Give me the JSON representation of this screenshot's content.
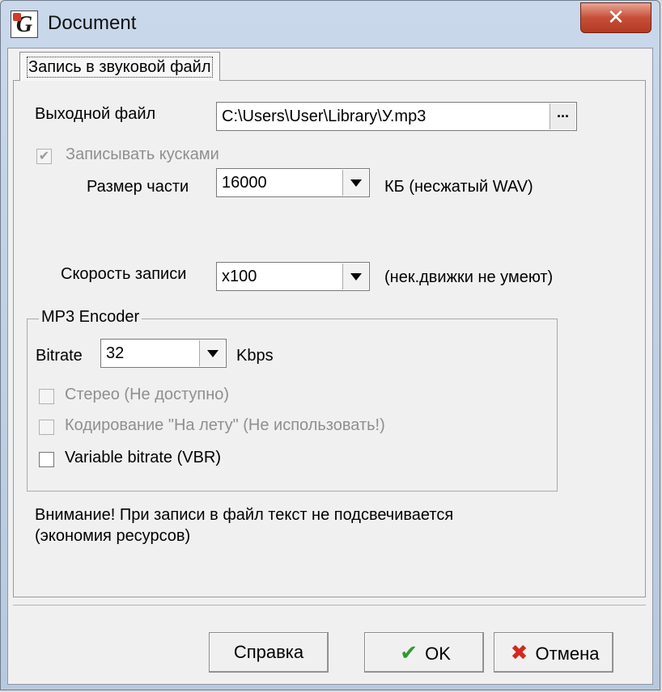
{
  "window": {
    "title": "Document",
    "close_glyph": "✕",
    "app_icon": "G"
  },
  "tabs": [
    {
      "label": "Запись в звуковой файл",
      "selected": true
    }
  ],
  "output_file": {
    "label": "Выходной файл",
    "value": "C:\\Users\\User\\Library\\У.mp3",
    "browse_label": "..."
  },
  "record_chunks": {
    "label": "Записывать кусками",
    "checked": true,
    "enabled": false
  },
  "chunk_size": {
    "label": "Размер части",
    "value": "16000",
    "unit": "КБ (несжатый WAV)"
  },
  "record_speed": {
    "label": "Скорость записи",
    "value": "x100",
    "note": "(нек.движки не умеют)"
  },
  "mp3_encoder": {
    "title": "MP3 Encoder",
    "bitrate_label": "Bitrate",
    "bitrate_value": "32",
    "bitrate_unit": "Kbps",
    "stereo": {
      "label": "Стерео (Не доступно)",
      "checked": false,
      "enabled": false
    },
    "on_the_fly": {
      "label": "Кодирование \"На лету\" (Не использовать!)",
      "checked": false,
      "enabled": false
    },
    "vbr": {
      "label": "Variable bitrate (VBR)",
      "checked": false,
      "enabled": true
    }
  },
  "warning": {
    "line1": "Внимание! При записи в файл текст не подсвечивается",
    "line2": "(экономия ресурсов)"
  },
  "buttons": {
    "help": "Справка",
    "ok": "OK",
    "cancel": "Отмена",
    "ok_glyph": "✔",
    "cancel_glyph": "✖"
  },
  "colors": {
    "ok_icon": "#2f9a2f",
    "cancel_icon": "#d22a1c",
    "close_button": "#c74f38"
  }
}
